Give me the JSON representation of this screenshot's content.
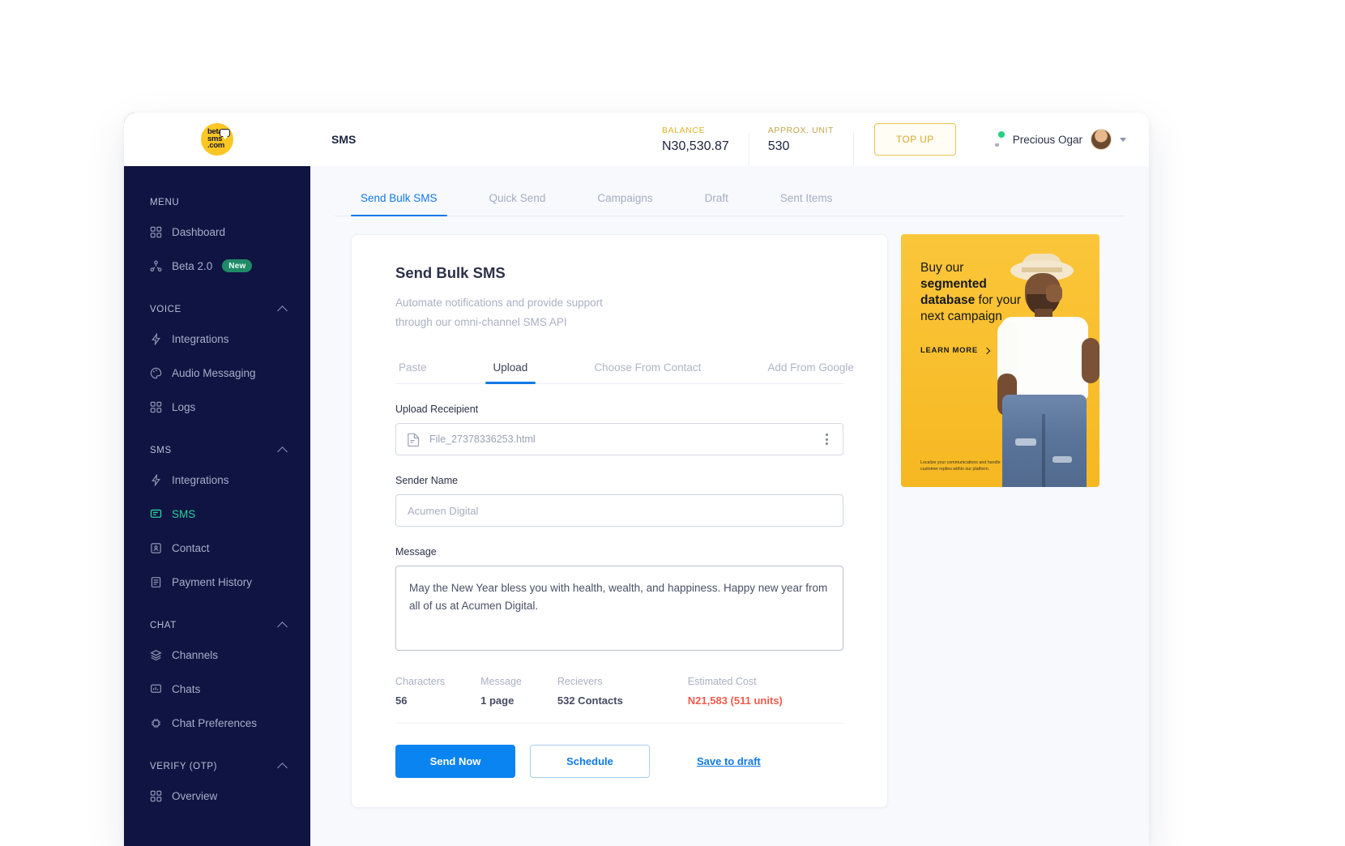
{
  "app": {
    "logo_text_line1": "beta",
    "logo_text_line2": "sms",
    "logo_text_line3": ".com",
    "topbar_title": "SMS"
  },
  "topbar": {
    "balance_label": "BALANCE",
    "balance_value": "N30,530.87",
    "unit_label": "APPROX. UNIT",
    "unit_value": "530",
    "topup_label": "TOP UP",
    "user_name": "Precious Ogar"
  },
  "sidebar": {
    "menu_label": "MENU",
    "top_items": [
      {
        "label": "Dashboard",
        "icon": "grid-icon",
        "active": false,
        "badge": ""
      },
      {
        "label": "Beta 2.0",
        "icon": "share-icon",
        "active": false,
        "badge": "New"
      }
    ],
    "sections": [
      {
        "title": "VOICE",
        "items": [
          {
            "label": "Integrations",
            "icon": "bolt-icon",
            "active": false
          },
          {
            "label": "Audio Messaging",
            "icon": "palette-icon",
            "active": false
          },
          {
            "label": "Logs",
            "icon": "grid-icon",
            "active": false
          }
        ]
      },
      {
        "title": "SMS",
        "items": [
          {
            "label": "Integrations",
            "icon": "bolt-icon",
            "active": false
          },
          {
            "label": "SMS",
            "icon": "chat-icon",
            "active": true
          },
          {
            "label": "Contact",
            "icon": "contact-icon",
            "active": false
          },
          {
            "label": "Payment History",
            "icon": "receipt-icon",
            "active": false
          }
        ]
      },
      {
        "title": "CHAT",
        "items": [
          {
            "label": "Channels",
            "icon": "layers-icon",
            "active": false
          },
          {
            "label": "Chats",
            "icon": "chat-bars-icon",
            "active": false
          },
          {
            "label": "Chat Preferences",
            "icon": "chip-icon",
            "active": false
          }
        ]
      },
      {
        "title": "VERIFY (OTP)",
        "items": [
          {
            "label": "Overview",
            "icon": "grid-icon",
            "active": false
          }
        ]
      }
    ]
  },
  "main": {
    "tabs": [
      {
        "label": "Send Bulk SMS",
        "active": true
      },
      {
        "label": "Quick Send",
        "active": false
      },
      {
        "label": "Campaigns",
        "active": false
      },
      {
        "label": "Draft",
        "active": false
      },
      {
        "label": "Sent Items",
        "active": false
      }
    ]
  },
  "card": {
    "title": "Send Bulk SMS",
    "subtitle_line1": "Automate notifications and provide support",
    "subtitle_line2": "through our omni-channel SMS API",
    "inner_tabs": [
      {
        "label": "Paste",
        "active": false
      },
      {
        "label": "Upload",
        "active": true
      },
      {
        "label": "Choose From Contact",
        "active": false
      },
      {
        "label": "Add From Google",
        "active": false
      }
    ],
    "upload_label": "Upload Receipient",
    "upload_file_name": "File_27378336253.html",
    "sender_label": "Sender Name",
    "sender_placeholder": "Acumen Digital",
    "sender_value": "",
    "message_label": "Message",
    "message_value": "May the New Year bless you with health, wealth, and happiness. Happy new year from all of us at Acumen Digital.",
    "stats": [
      {
        "label": "Characters",
        "value": "56",
        "cost": false
      },
      {
        "label": "Message",
        "value": "1 page",
        "cost": false
      },
      {
        "label": "Recievers",
        "value": "532 Contacts",
        "cost": false
      },
      {
        "label": "Estimated Cost",
        "value": "N21,583 (511 units)",
        "cost": true
      }
    ],
    "send_label": "Send Now",
    "schedule_label": "Schedule",
    "draft_label": "Save to draft"
  },
  "promo": {
    "head_1": "Buy our ",
    "head_bold": "segmented database",
    "head_2": " for your next campaign",
    "cta": "LEARN MORE",
    "fine_print": "Localize your communications and handle customer replies within our platform."
  },
  "colors": {
    "sidebar_bg": "#101442",
    "accent_blue": "#1179e7",
    "accent_green": "#2ad19a",
    "accent_yellow": "#fcc623",
    "cost_red": "#f15b4e"
  }
}
